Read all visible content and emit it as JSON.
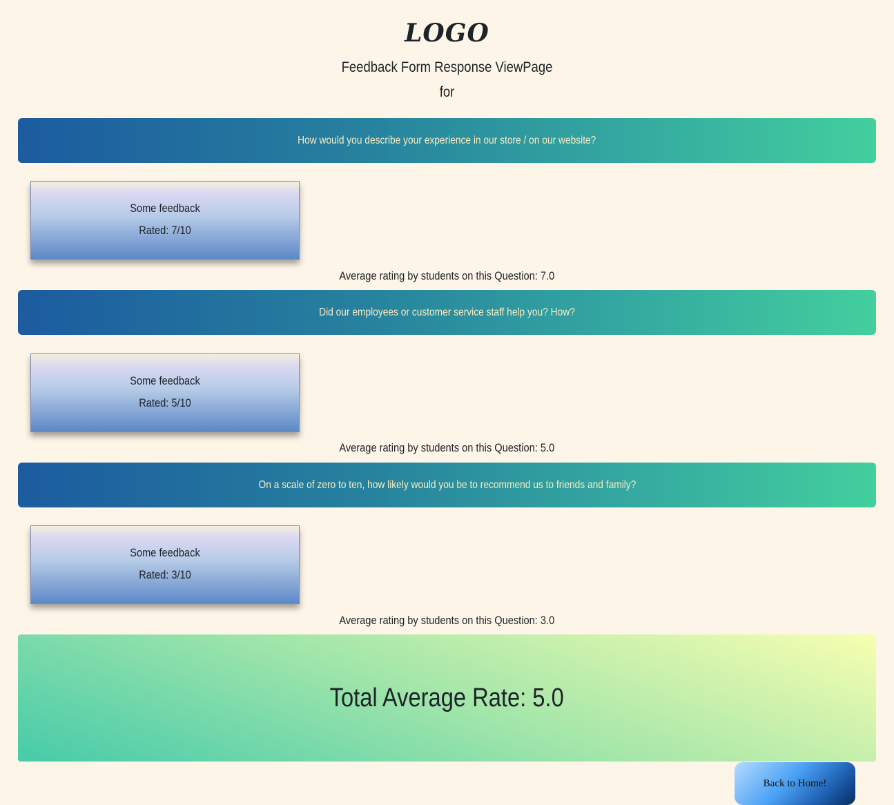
{
  "header": {
    "logo": "LOGO",
    "title": "Feedback Form Response ViewPage",
    "subtitle": "for"
  },
  "questions": [
    {
      "text": "How would you describe your experience in our store / on our website?",
      "responses": [
        {
          "feedback": "Some feedback",
          "rated": "Rated: 7/10"
        }
      ],
      "average": "Average rating by students on this Question: 7.0"
    },
    {
      "text": "Did our employees or customer service staff help you? How?",
      "responses": [
        {
          "feedback": "Some feedback",
          "rated": "Rated: 5/10"
        }
      ],
      "average": "Average rating by students on this Question: 5.0"
    },
    {
      "text": "On a scale of zero to ten, how likely would you be to recommend us to friends and family?",
      "responses": [
        {
          "feedback": "Some feedback",
          "rated": "Rated: 3/10"
        }
      ],
      "average": "Average rating by students on this Question: 3.0"
    }
  ],
  "total": {
    "label": "Total Average Rate: 5.0"
  },
  "actions": {
    "back_label": "Back to Home!"
  },
  "colors": {
    "page_background": "#fdf5e8",
    "question_bar_start": "#1c5b9f",
    "question_bar_end": "#43cf9e",
    "question_text": "#f9ecc3",
    "text_dark": "#1e2329"
  }
}
